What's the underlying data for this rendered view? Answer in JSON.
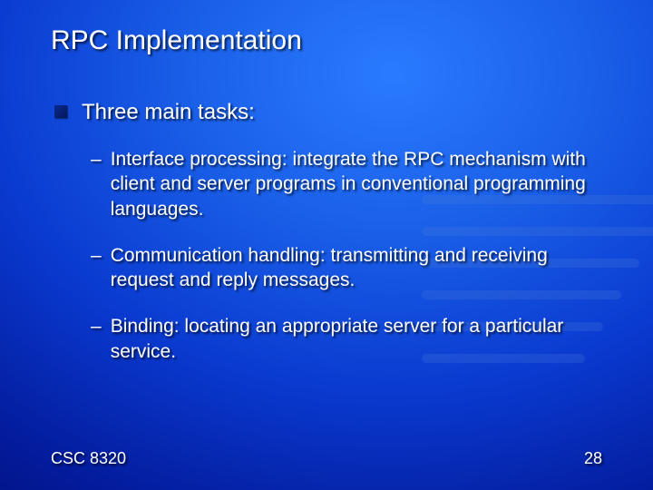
{
  "title": "RPC Implementation",
  "bullet": {
    "heading": "Three main tasks:",
    "items": [
      "Interface processing: integrate the RPC mechanism with client and server programs in conventional programming languages.",
      "Communication handling: transmitting and receiving request and reply messages.",
      "Binding: locating an appropriate server for a particular service."
    ]
  },
  "footer": {
    "left": "CSC 8320",
    "right": "28"
  }
}
